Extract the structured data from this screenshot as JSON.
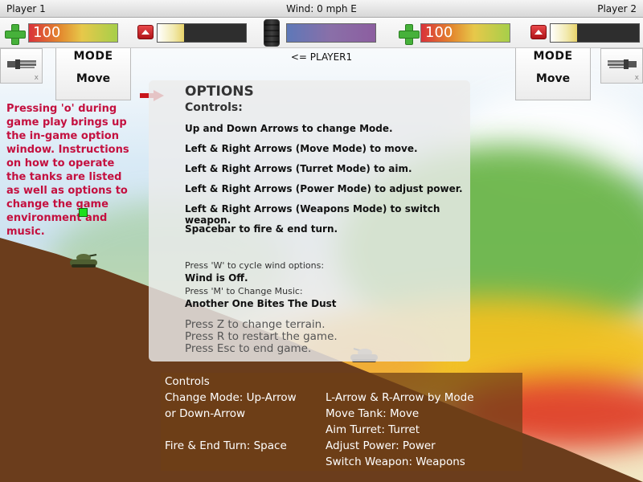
{
  "window": {
    "player1_name": "Player 1",
    "player2_name": "Player 2",
    "wind_status": "Wind: 0 mph E",
    "turn_indicator": "<= PLAYER1"
  },
  "player1": {
    "health": "100",
    "power_level": 0.3,
    "mode_title": "MODE",
    "mode_value": "Move",
    "weapon_icon": "gatling-gun-icon",
    "weapon_close": "x"
  },
  "player2": {
    "health": "100",
    "power_level": 0.3,
    "mode_title": "MODE",
    "mode_value": "Move",
    "weapon_icon": "gatling-gun-icon",
    "weapon_close": "x"
  },
  "side_note": "Pressing 'o' during game play brings up the in-game option window.  Instructions on how to operate the tanks are listed as well as options to change the game environment and music.",
  "options": {
    "title": "OPTIONS",
    "subtitle": "Controls:",
    "lines": [
      "Up and Down Arrows to change Mode.",
      "Left & Right Arrows (Move Mode) to move.",
      "Left & Right Arrows (Turret Mode) to aim.",
      "Left & Right Arrows (Power Mode) to adjust power.",
      "Left & Right Arrows (Weapons Mode) to switch weapon.",
      "Spacebar to fire & end turn."
    ],
    "wind_hint": "Press 'W' to cycle wind options:",
    "wind_value": "Wind is Off.",
    "music_hint": "Press 'M' to Change Music:",
    "music_value": "Another One Bites The Dust",
    "extra": [
      "Press Z to change terrain.",
      "Press R to restart the game.",
      "Press Esc to end game."
    ]
  },
  "controls": {
    "header": "Controls",
    "left": [
      "Change Mode: Up-Arrow",
      "or Down-Arrow",
      "",
      "Fire & End Turn: Space"
    ],
    "right": [
      "L-Arrow & R-Arrow by Mode",
      "Move Tank: Move",
      "Aim Turret: Turret",
      "Adjust Power: Power",
      "Switch Weapon: Weapons"
    ]
  },
  "colors": {
    "note_text": "#c4103f",
    "terrain": "#6b3d1c",
    "health_bar": "#d9323a",
    "plus_icon": "#46b13a"
  }
}
